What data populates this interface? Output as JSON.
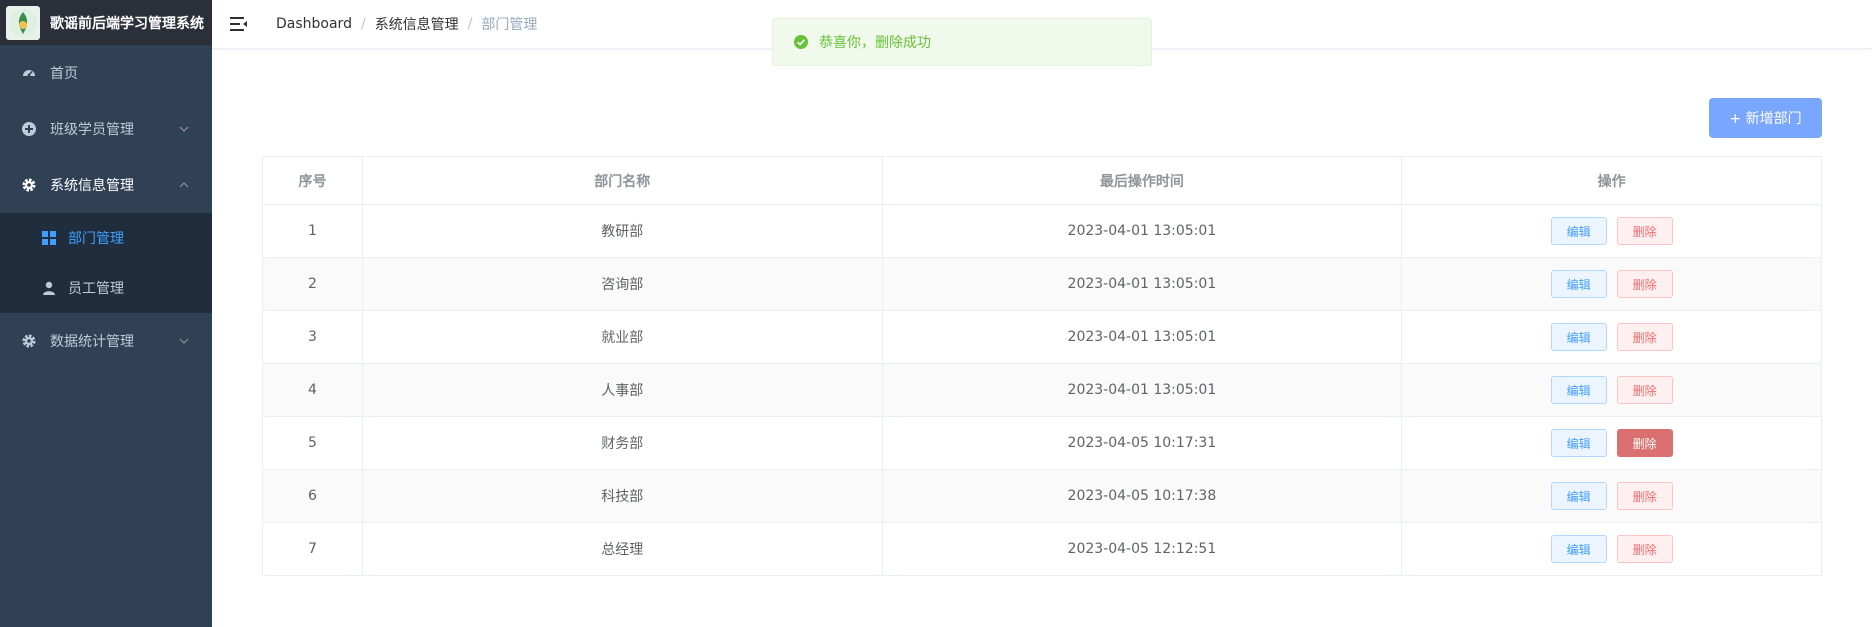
{
  "app": {
    "title": "歌谣前后端学习管理系统"
  },
  "sidebar": {
    "items": [
      {
        "label": "首页",
        "icon": "dashboard-icon"
      },
      {
        "label": "班级学员管理",
        "icon": "plus-circle-icon"
      },
      {
        "label": "系统信息管理",
        "icon": "gear-icon",
        "expanded": true,
        "children": [
          {
            "label": "部门管理",
            "icon": "grid-icon",
            "active": true
          },
          {
            "label": "员工管理",
            "icon": "user-icon"
          }
        ]
      },
      {
        "label": "数据统计管理",
        "icon": "gear-icon"
      }
    ]
  },
  "header": {
    "breadcrumb": [
      "Dashboard",
      "系统信息管理",
      "部门管理"
    ],
    "separator": "/"
  },
  "toast": {
    "message": "恭喜你，删除成功",
    "type": "success"
  },
  "toolbar": {
    "add_label": "+ 新增部门"
  },
  "table": {
    "columns": [
      "序号",
      "部门名称",
      "最后操作时间",
      "操作"
    ],
    "edit_label": "编辑",
    "delete_label": "删除",
    "rows": [
      {
        "seq": "1",
        "name": "教研部",
        "time": "2023-04-01 13:05:01"
      },
      {
        "seq": "2",
        "name": "咨询部",
        "time": "2023-04-01 13:05:01"
      },
      {
        "seq": "3",
        "name": "就业部",
        "time": "2023-04-01 13:05:01"
      },
      {
        "seq": "4",
        "name": "人事部",
        "time": "2023-04-01 13:05:01"
      },
      {
        "seq": "5",
        "name": "财务部",
        "time": "2023-04-05 10:17:31"
      },
      {
        "seq": "6",
        "name": "科技部",
        "time": "2023-04-05 10:17:38"
      },
      {
        "seq": "7",
        "name": "总经理",
        "time": "2023-04-05 12:12:51"
      }
    ]
  },
  "colors": {
    "sidebar_bg": "#304156",
    "submenu_bg": "#1f2d3d",
    "accent": "#409eff",
    "success": "#67c23a",
    "danger": "#f56c6c"
  }
}
